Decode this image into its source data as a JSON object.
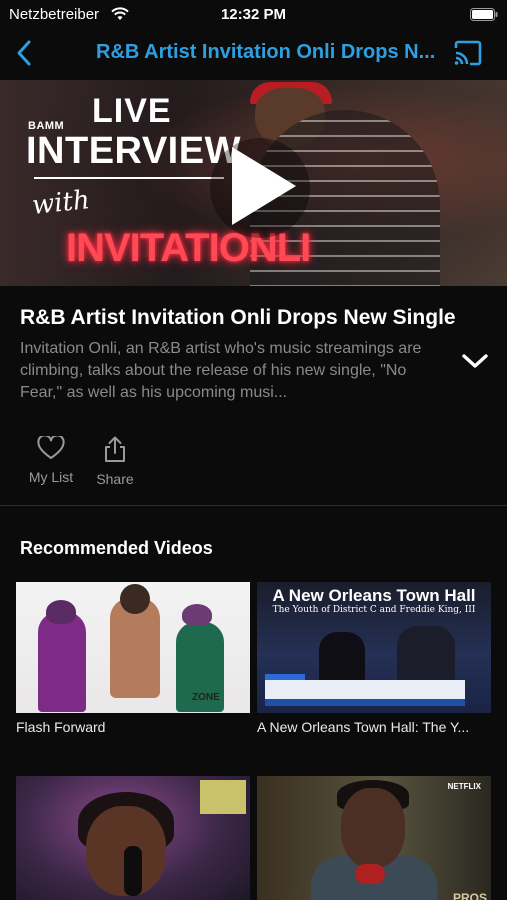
{
  "status_bar": {
    "carrier": "Netzbetreiber",
    "time": "12:32 PM"
  },
  "nav": {
    "title": "R&B Artist Invitation Onli Drops N...",
    "accent_color": "#2e9fe0"
  },
  "hero": {
    "live_text": "LIVE",
    "interview_text": "INTERVIEW",
    "brand_text": "BAMM",
    "with_text": "with",
    "neon_text": "INVITATIONLI"
  },
  "video": {
    "title": "R&B Artist Invitation Onli Drops New Single",
    "description": "Invitation Onli, an R&B artist who's music streamings are climbing, talks about the release of his new single, \"No Fear,\" as well as his upcoming musi..."
  },
  "actions": {
    "my_list": "My List",
    "share": "Share"
  },
  "recommended": {
    "title": "Recommended Videos",
    "items": [
      {
        "label": "Flash Forward",
        "badge": "ZONE"
      },
      {
        "label": "A New Orleans Town Hall: The Y...",
        "thumb_title": "A New Orleans Town Hall",
        "thumb_subtitle": "The Youth of District C and Freddie King, III"
      },
      {
        "label": "",
        "badge": ""
      },
      {
        "label": "",
        "badge": "NETFLIX",
        "corner": "PROS"
      }
    ]
  },
  "icons": {
    "back": "chevron-left-icon",
    "cast": "cast-icon",
    "play": "play-icon",
    "expand": "chevron-down-icon",
    "my_list": "heart-icon",
    "share": "share-icon"
  }
}
